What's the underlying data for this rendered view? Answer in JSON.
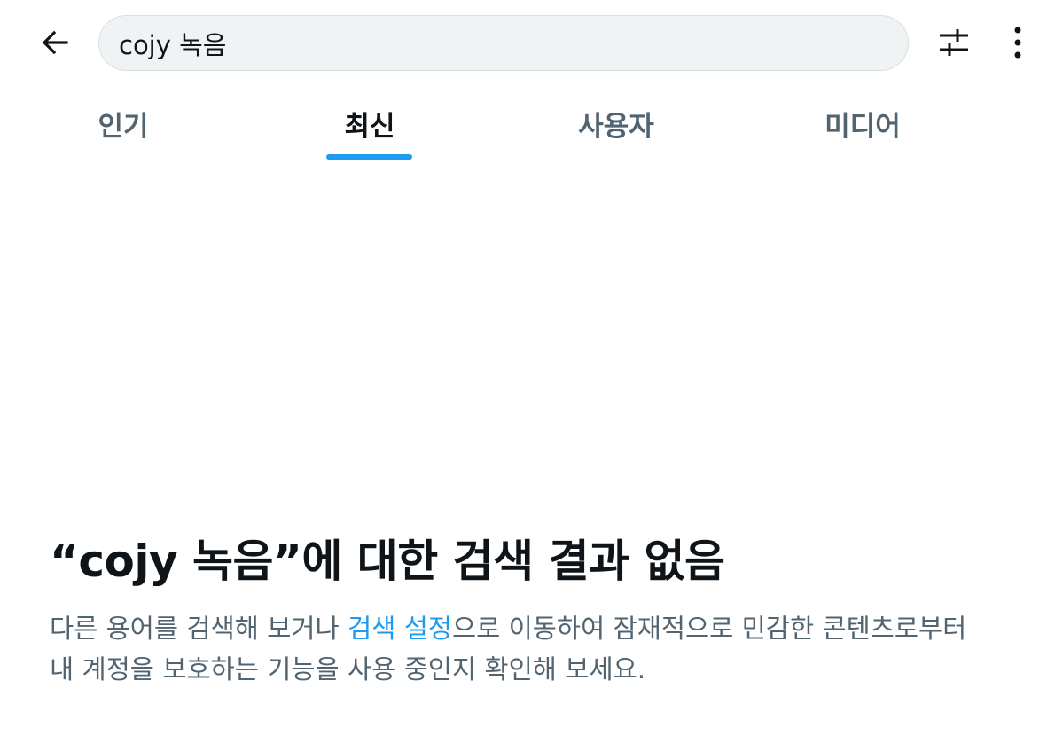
{
  "search": {
    "query": "cojy 녹음"
  },
  "header": {
    "back_icon": "arrow-left-icon",
    "filter_icon": "sliders-icon",
    "more_icon": "more-vertical-icon"
  },
  "tabs": [
    {
      "label": "인기",
      "active": false
    },
    {
      "label": "최신",
      "active": true
    },
    {
      "label": "사용자",
      "active": false
    },
    {
      "label": "미디어",
      "active": false
    }
  ],
  "empty_state": {
    "title": "“cojy 녹음”에 대한 검색 결과 없음",
    "desc_before_link": "다른 용어를 검색해 보거나 ",
    "link": "검색 설정",
    "desc_after_link_line1": "으로 이동하여 잠재적으로 민감한 콘텐츠로부터",
    "desc_line2": "내 계정을 보호하는 기능을 사용 중인지 확인해 보세요."
  },
  "colors": {
    "accent": "#1d9bf0",
    "text_primary": "#0f1419",
    "text_secondary": "#536471",
    "search_bg": "#eff3f4"
  }
}
